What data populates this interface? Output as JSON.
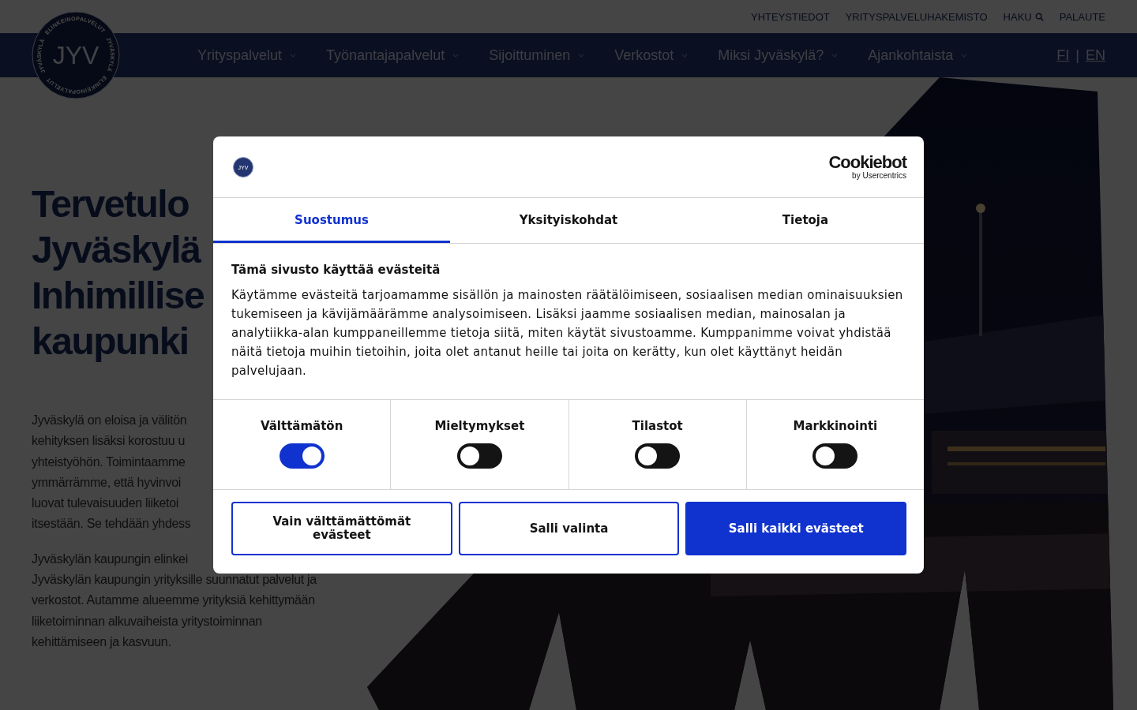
{
  "top_links": [
    {
      "label": "YHTEYSTIEDOT",
      "kind": "link"
    },
    {
      "label": "YRITYSPALVELUHAKEMISTO",
      "kind": "link"
    },
    {
      "label": "HAKU",
      "kind": "search"
    },
    {
      "label": "PALAUTE",
      "kind": "link"
    }
  ],
  "logo": {
    "text": "JYV",
    "ring": [
      "ELINKEINOPALVELUT",
      "JYVÄSKYLÄ",
      "JYVÄSKYLÄ",
      "ELINKEINOPALVELUT"
    ]
  },
  "nav": [
    "Yrityspalvelut",
    "Työnantajapalvelut",
    "Sijoittuminen",
    "Verkostot",
    "Miksi Jyväskylä?",
    "Ajankohtaista"
  ],
  "languages": [
    "FI",
    "EN"
  ],
  "language_separator": "|",
  "hero": {
    "heading_lines": [
      "Tervetulo",
      "Jyväskylä",
      "Inhimillise",
      "kaupunki"
    ],
    "paragraphs": [
      [
        "Jyväskylä on eloisa ja välitön",
        "kehityksen lisäksi korostuu u",
        "yhteistyöhön. Toimintaamme",
        "ymmärrämme, että hyvinvoi",
        "luovat tulevaisuuden liiketoi",
        "itsestään. Se tehdään yhdess"
      ],
      [
        "Jyväskylän kaupungin elinkei",
        "Jyväskylän kaupungin yrityksille suunnatut palvelut ja",
        "verkostot. Autamme alueemme yrityksiä kehittymään",
        "liiketoiminnan alkuvaiheista yritystoiminnan",
        "kehittämiseen ja kasvuun."
      ]
    ]
  },
  "cookie_dialog": {
    "logo_text": "JYV",
    "brand": "Cookiebot",
    "brand_sub": "by Usercentrics",
    "tabs": [
      {
        "label": "Suostumus",
        "selected": true
      },
      {
        "label": "Yksityiskohdat",
        "selected": false
      },
      {
        "label": "Tietoja",
        "selected": false
      }
    ],
    "title": "Tämä sivusto käyttää evästeitä",
    "body": "Käytämme evästeitä tarjoamamme sisällön ja mainosten räätälöimiseen, sosiaalisen median ominaisuuksien tukemiseen ja kävijämäärämme analysoimiseen. Lisäksi jaamme sosiaalisen median, mainosalan ja analytiikka-alan kumppaneillemme tietoja siitä, miten käytät sivustoamme. Kumppanimme voivat yhdistää näitä tietoja muihin tietoihin, joita olet antanut heille tai joita on kerätty, kun olet käyttänyt heidän palvelujaan.",
    "categories": [
      {
        "label": "Välttämätön",
        "on": true
      },
      {
        "label": "Mieltymykset",
        "on": false
      },
      {
        "label": "Tilastot",
        "on": false
      },
      {
        "label": "Markkinointi",
        "on": false
      }
    ],
    "buttons": [
      {
        "label": "Vain välttämättömät evästeet",
        "kind": "outline"
      },
      {
        "label": "Salli valinta",
        "kind": "outline"
      },
      {
        "label": "Salli kaikki evästeet",
        "kind": "primary"
      }
    ]
  }
}
